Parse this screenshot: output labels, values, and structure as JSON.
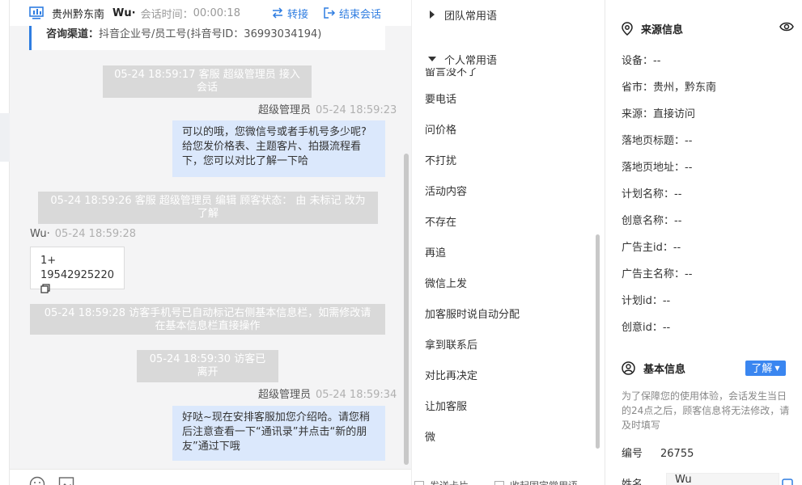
{
  "header": {
    "region": "贵州黔东南",
    "visitor": "Wu·",
    "time_label": "会话时间：",
    "time_value": "00:00:18",
    "transfer": "转接",
    "end": "结束会话"
  },
  "channel": {
    "label": "咨询渠道：",
    "value": "抖音企业号/员工号(抖音号ID：36993034194)"
  },
  "messages": {
    "sys1": "05-24 18:59:17 客服 超级管理员 接入会话",
    "agent1_name": "超级管理员",
    "agent1_time": "05-24 18:59:23",
    "agent1_text": "可以的哦，您微信号或者手机号多少呢?给您发价格表、主题客片、拍摄流程看下，您可以对比了解一下哈",
    "sys2": "05-24 18:59:26 客服 超级管理员 编辑 顾客状态： 由 未标记 改为 了解",
    "visitor1_name": "Wu·",
    "visitor1_time": "05-24 18:59:28",
    "visitor1_line1": "1+",
    "visitor1_line2": "19542925220",
    "sys3": "05-24 18:59:28 访客手机号已自动标记右侧基本信息栏，如需修改请在基本信息栏直接操作",
    "sys4": "05-24 18:59:30 访客已离开",
    "agent2_name": "超级管理员",
    "agent2_time": "05-24 18:59:34",
    "agent2_text": "好哒~现在安排客服加您介绍哈。请您稍后注意查看一下“通讯录”并点击“新的朋友”通过下哦"
  },
  "phrases": {
    "team_group": "团队常用语",
    "personal_group": "个人常用语",
    "cut_item": "留言没不了",
    "items": [
      "要电话",
      "问价格",
      "不打扰",
      "活动内容",
      "不存在",
      "再追",
      "微信上发",
      "加客服时说自动分配",
      "拿到联系后",
      "对比再决定",
      "让加客服",
      "微"
    ],
    "bottom_left": "发送卡片",
    "bottom_right": "收起固定常用语"
  },
  "source": {
    "title": "来源信息",
    "device": "设备：--",
    "province": "省市：贵州，黔东南",
    "origin": "来源：直接访问",
    "landing_title": "落地页标题：--",
    "landing_url": "落地页地址：--",
    "plan_name": "计划名称：--",
    "creative_name": "创意名称：--",
    "advertiser_id": "广告主id：--",
    "advertiser_name": "广告主名称：--",
    "plan_id": "计划id：--",
    "creative_id": "创意id：--"
  },
  "basic": {
    "title": "基本信息",
    "learn": "了解",
    "notice": "为了保障您的使用体验，会话发生当日的24点之后，顾客信息将无法修改，请及时填写",
    "id_label": "编号",
    "id_value": "26755",
    "name_label": "姓名",
    "name_value": "Wu"
  },
  "colors": {
    "accent": "#2f7de1",
    "agent_bubble": "#dbe8fc",
    "system_bg": "#d9d9d9"
  }
}
